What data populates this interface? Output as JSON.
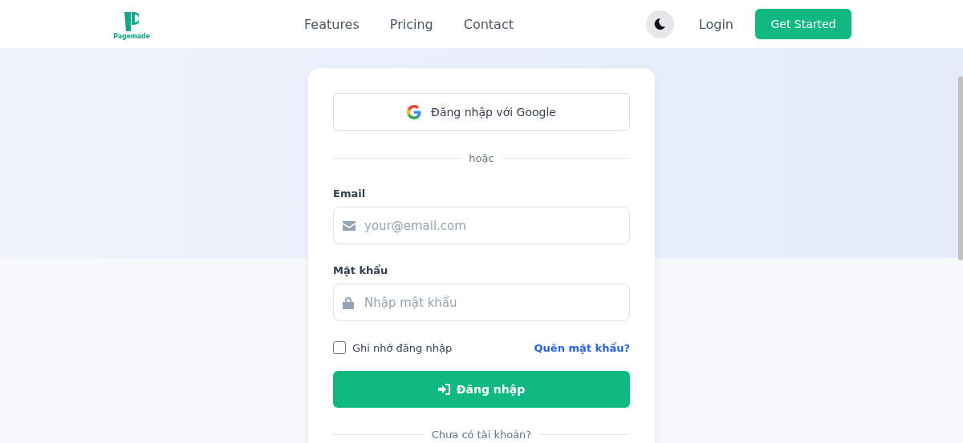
{
  "header": {
    "logo_text": "Pagemade",
    "nav": [
      {
        "label": "Features"
      },
      {
        "label": "Pricing"
      },
      {
        "label": "Contact"
      }
    ],
    "dark_mode": false,
    "login": "Login",
    "cta": "Get Started"
  },
  "login_form": {
    "google_button": "Đăng nhập với Google",
    "divider": "hoặc",
    "fields": [
      {
        "kind": "email",
        "label": "Email",
        "placeholder": "your@email.com"
      },
      {
        "kind": "password",
        "label": "Mật khẩu",
        "placeholder": "Nhập mật khẩu"
      }
    ],
    "remember": {
      "label": "Ghi nhớ đăng nhập",
      "checked": false
    },
    "forgot_link": "Quên mật khẩu?",
    "submit": "Đăng nhập",
    "signup_divider": "Chưa có tài khoản?"
  }
}
